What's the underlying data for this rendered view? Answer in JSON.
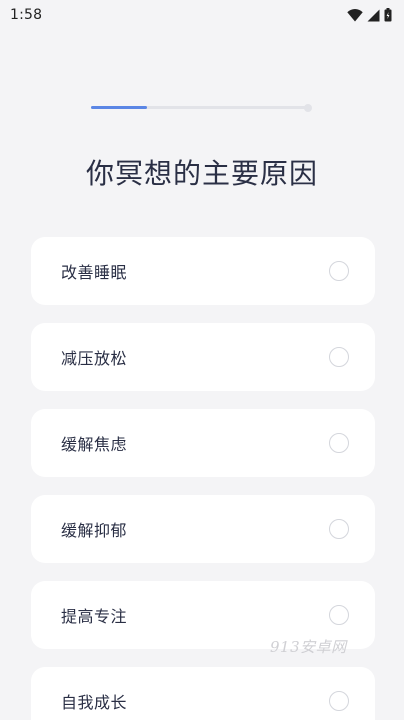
{
  "status_bar": {
    "time": "1:58",
    "icons": [
      "wifi-icon",
      "signal-icon",
      "battery-icon"
    ]
  },
  "progress": {
    "fraction": 0.26,
    "fill_color": "#5b86e5",
    "track_color": "#e2e3e8"
  },
  "page": {
    "title": "你冥想的主要原因"
  },
  "options": [
    {
      "label": "改善睡眠",
      "selected": false
    },
    {
      "label": "减压放松",
      "selected": false
    },
    {
      "label": "缓解焦虑",
      "selected": false
    },
    {
      "label": "缓解抑郁",
      "selected": false
    },
    {
      "label": "提高专注",
      "selected": false
    },
    {
      "label": "自我成长",
      "selected": false
    }
  ],
  "watermark": {
    "text": "913安卓网"
  }
}
